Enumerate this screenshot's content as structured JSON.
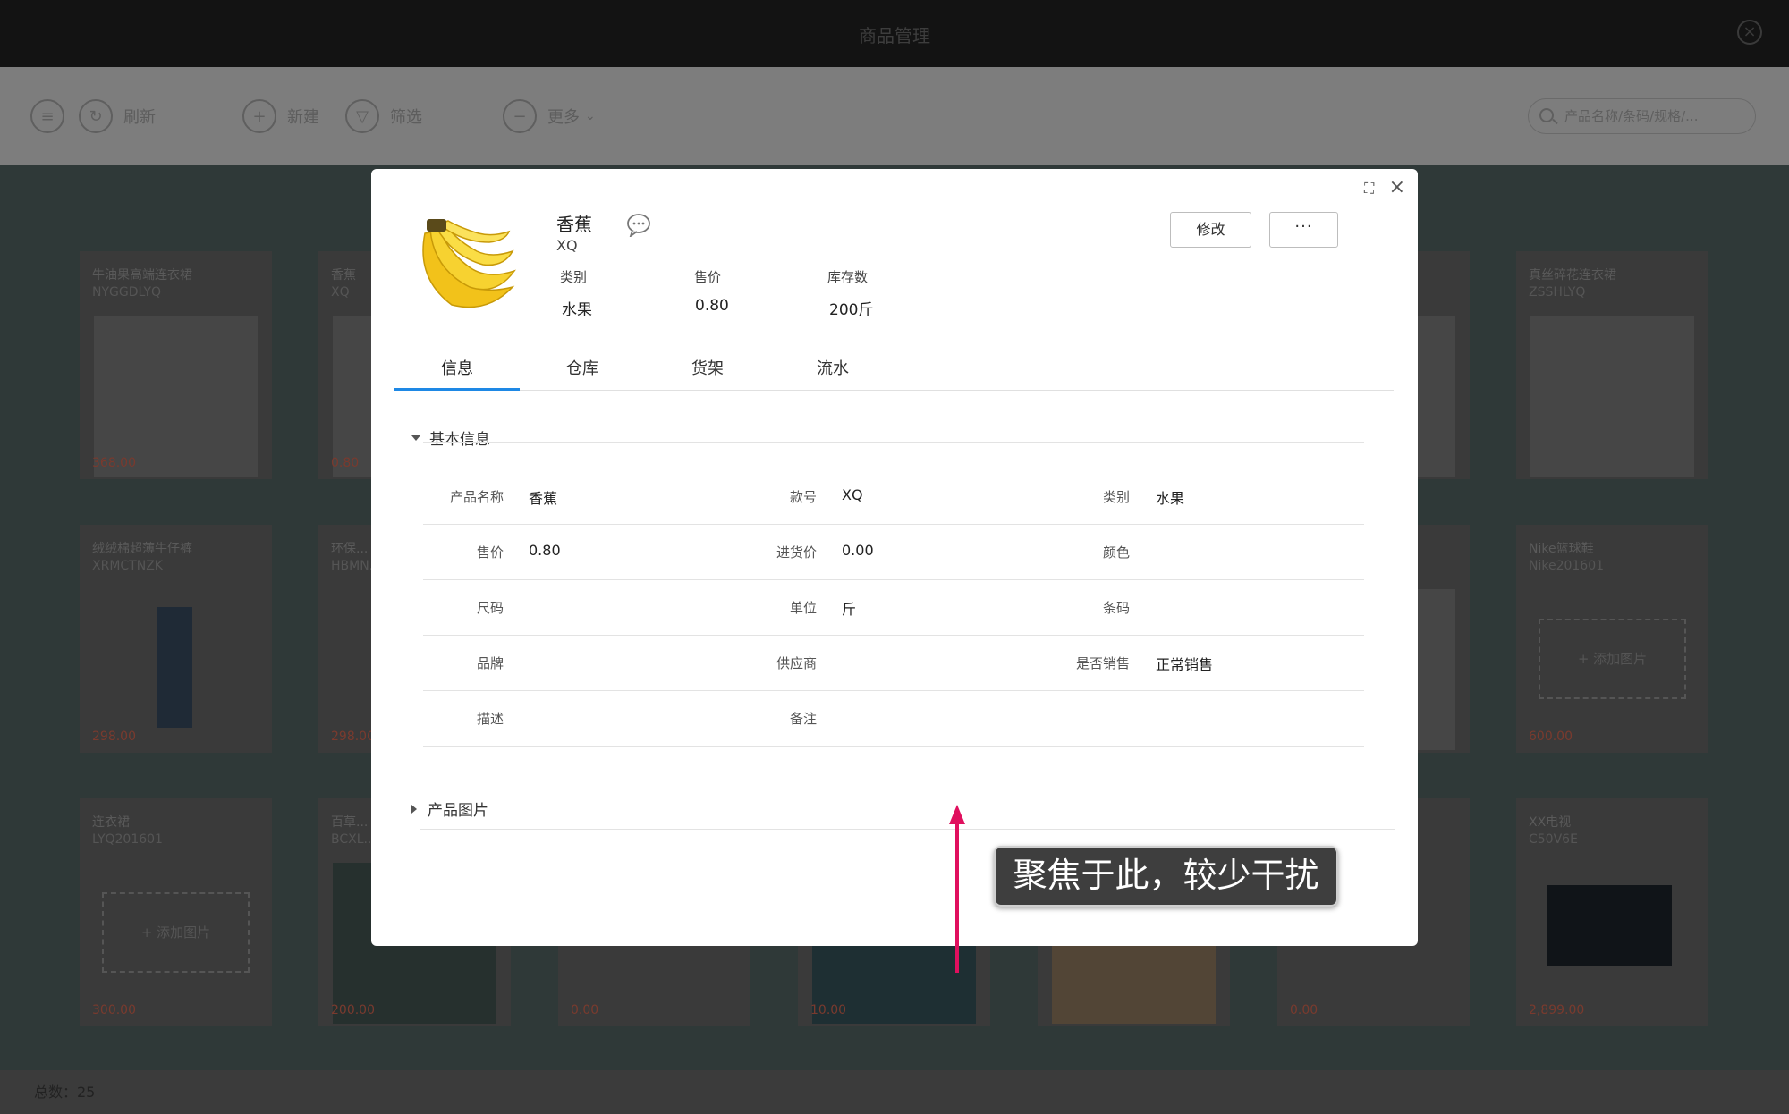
{
  "app": {
    "title": "商品管理",
    "toolbar": {
      "refresh_label": "刷新",
      "new_label": "新建",
      "filter_label": "筛选",
      "more_label": "更多",
      "search_placeholder": "产品名称/条码/规格/..."
    },
    "cards": [
      {
        "name": "牛油果高端连衣裙",
        "code": "NYGGDLYQ",
        "price": "368.00"
      },
      {
        "name": "香蕉",
        "code": "XQ",
        "price": "0.80"
      },
      {
        "name": "",
        "code": "",
        "price": ""
      },
      {
        "name": "",
        "code": "",
        "price": ""
      },
      {
        "name": "",
        "code": "",
        "price": ""
      },
      {
        "name": "",
        "code": "",
        "price": ""
      },
      {
        "name": "真丝碎花连衣裙",
        "code": "ZSSHLYQ",
        "price": ""
      },
      {
        "name": "绒绒棉超薄牛仔裤",
        "code": "XRMCTNZK",
        "price": "298.00"
      },
      {
        "name": "环保...",
        "code": "HBMN...",
        "price": "298.00"
      },
      {
        "name": "Nike篮球鞋",
        "code": "Nike201601",
        "price": "600.00"
      },
      {
        "name": "连衣裙",
        "code": "LYQ201601",
        "price": "300.00"
      },
      {
        "name": "百草...",
        "code": "BCXL...",
        "price": "200.00"
      },
      {
        "name": "",
        "code": "",
        "price": "0.00"
      },
      {
        "name": "",
        "code": "",
        "price": "10.00"
      },
      {
        "name": "",
        "code": "",
        "price": "0.00"
      },
      {
        "name": "XX电视",
        "code": "C50V6E",
        "price": "2,899.00"
      }
    ],
    "add_image_label": "+ 添加图片",
    "footer_total": "总数：25"
  },
  "modal": {
    "product": {
      "name": "香蕉",
      "code": "XQ",
      "stats": [
        {
          "label": "类别",
          "value": "水果"
        },
        {
          "label": "售价",
          "value": "0.80"
        },
        {
          "label": "库存数",
          "value": "200斤"
        }
      ]
    },
    "edit_label": "修改",
    "more_label": "···",
    "tabs": [
      "信息",
      "仓库",
      "货架",
      "流水"
    ],
    "section_basic": "基本信息",
    "section_images": "产品图片",
    "rows": [
      [
        {
          "label": "产品名称",
          "value": "香蕉"
        },
        {
          "label": "款号",
          "value": "XQ"
        },
        {
          "label": "类别",
          "value": "水果"
        }
      ],
      [
        {
          "label": "售价",
          "value": "0.80"
        },
        {
          "label": "进货价",
          "value": "0.00"
        },
        {
          "label": "颜色",
          "value": ""
        }
      ],
      [
        {
          "label": "尺码",
          "value": ""
        },
        {
          "label": "单位",
          "value": "斤"
        },
        {
          "label": "条码",
          "value": ""
        }
      ],
      [
        {
          "label": "品牌",
          "value": ""
        },
        {
          "label": "供应商",
          "value": ""
        },
        {
          "label": "是否销售",
          "value": "正常销售"
        }
      ],
      [
        {
          "label": "描述",
          "value": ""
        },
        {
          "label": "备注",
          "value": ""
        },
        {
          "label": "",
          "value": ""
        }
      ]
    ]
  },
  "annotation": {
    "text": "聚焦于此，较少干扰",
    "arrow_color": "#e0105e"
  }
}
